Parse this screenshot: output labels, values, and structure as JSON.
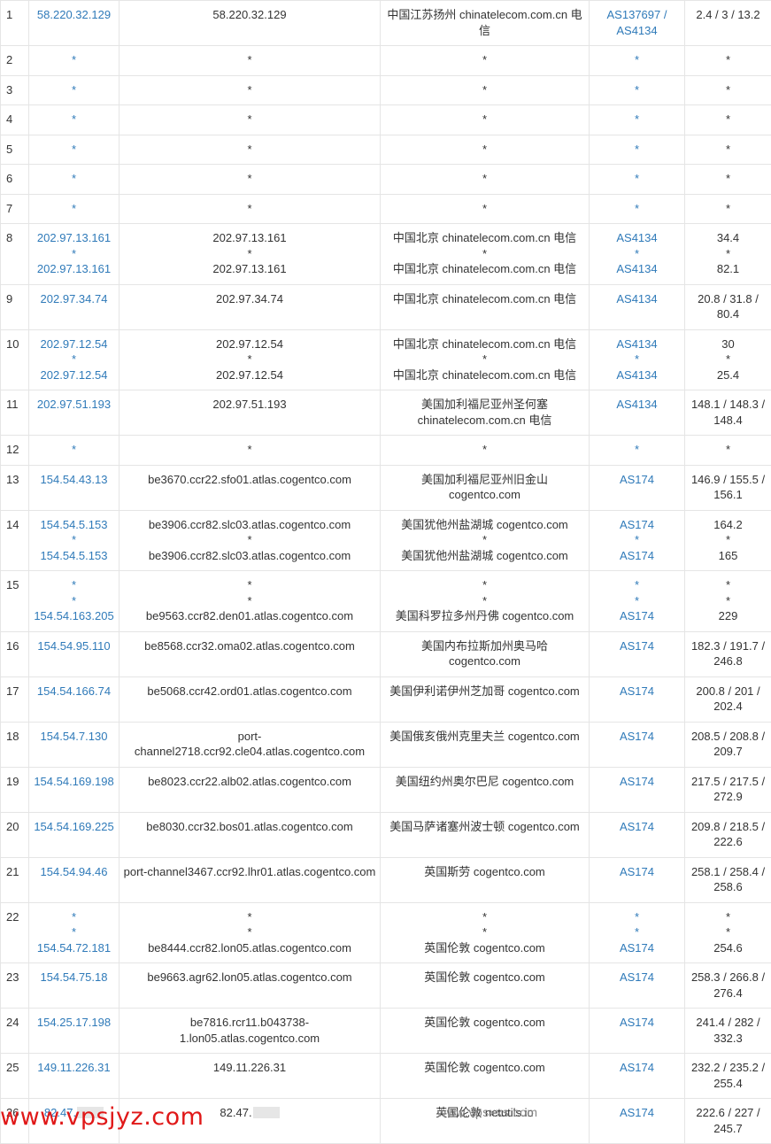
{
  "rows": [
    {
      "hop": "1",
      "ips": [
        "58.220.32.129"
      ],
      "hosts": [
        "58.220.32.129"
      ],
      "locs": [
        "中国江苏扬州 chinatelecom.com.cn 电信"
      ],
      "asns": [
        "AS137697 / AS4134"
      ],
      "times": [
        "2.4 / 3 / 13.2"
      ]
    },
    {
      "hop": "2",
      "ips": [
        "*"
      ],
      "hosts": [
        "*"
      ],
      "locs": [
        "*"
      ],
      "asns": [
        "*"
      ],
      "times": [
        "*"
      ]
    },
    {
      "hop": "3",
      "ips": [
        "*"
      ],
      "hosts": [
        "*"
      ],
      "locs": [
        "*"
      ],
      "asns": [
        "*"
      ],
      "times": [
        "*"
      ]
    },
    {
      "hop": "4",
      "ips": [
        "*"
      ],
      "hosts": [
        "*"
      ],
      "locs": [
        "*"
      ],
      "asns": [
        "*"
      ],
      "times": [
        "*"
      ]
    },
    {
      "hop": "5",
      "ips": [
        "*"
      ],
      "hosts": [
        "*"
      ],
      "locs": [
        "*"
      ],
      "asns": [
        "*"
      ],
      "times": [
        "*"
      ]
    },
    {
      "hop": "6",
      "ips": [
        "*"
      ],
      "hosts": [
        "*"
      ],
      "locs": [
        "*"
      ],
      "asns": [
        "*"
      ],
      "times": [
        "*"
      ]
    },
    {
      "hop": "7",
      "ips": [
        "*"
      ],
      "hosts": [
        "*"
      ],
      "locs": [
        "*"
      ],
      "asns": [
        "*"
      ],
      "times": [
        "*"
      ]
    },
    {
      "hop": "8",
      "ips": [
        "202.97.13.161",
        "*",
        "202.97.13.161"
      ],
      "hosts": [
        "202.97.13.161",
        "*",
        "202.97.13.161"
      ],
      "locs": [
        "中国北京 chinatelecom.com.cn 电信",
        "*",
        "中国北京 chinatelecom.com.cn 电信"
      ],
      "asns": [
        "AS4134",
        "*",
        "AS4134"
      ],
      "times": [
        "34.4",
        "*",
        "82.1"
      ]
    },
    {
      "hop": "9",
      "ips": [
        "202.97.34.74"
      ],
      "hosts": [
        "202.97.34.74"
      ],
      "locs": [
        "中国北京 chinatelecom.com.cn 电信"
      ],
      "asns": [
        "AS4134"
      ],
      "times": [
        "20.8 / 31.8 / 80.4"
      ]
    },
    {
      "hop": "10",
      "ips": [
        "202.97.12.54",
        "*",
        "202.97.12.54"
      ],
      "hosts": [
        "202.97.12.54",
        "*",
        "202.97.12.54"
      ],
      "locs": [
        "中国北京 chinatelecom.com.cn 电信",
        "*",
        "中国北京 chinatelecom.com.cn 电信"
      ],
      "asns": [
        "AS4134",
        "*",
        "AS4134"
      ],
      "times": [
        "30",
        "*",
        "25.4"
      ]
    },
    {
      "hop": "11",
      "ips": [
        "202.97.51.193"
      ],
      "hosts": [
        "202.97.51.193"
      ],
      "locs": [
        "美国加利福尼亚州圣何塞 chinatelecom.com.cn 电信"
      ],
      "asns": [
        "AS4134"
      ],
      "times": [
        "148.1 / 148.3 / 148.4"
      ]
    },
    {
      "hop": "12",
      "ips": [
        "*"
      ],
      "hosts": [
        "*"
      ],
      "locs": [
        "*"
      ],
      "asns": [
        "*"
      ],
      "times": [
        "*"
      ]
    },
    {
      "hop": "13",
      "ips": [
        "154.54.43.13"
      ],
      "hosts": [
        "be3670.ccr22.sfo01.atlas.cogentco.com"
      ],
      "locs": [
        "美国加利福尼亚州旧金山 cogentco.com"
      ],
      "asns": [
        "AS174"
      ],
      "times": [
        "146.9 / 155.5 / 156.1"
      ]
    },
    {
      "hop": "14",
      "ips": [
        "154.54.5.153",
        "*",
        "154.54.5.153"
      ],
      "hosts": [
        "be3906.ccr82.slc03.atlas.cogentco.com",
        "*",
        "be3906.ccr82.slc03.atlas.cogentco.com"
      ],
      "locs": [
        "美国犹他州盐湖城 cogentco.com",
        "*",
        "美国犹他州盐湖城 cogentco.com"
      ],
      "asns": [
        "AS174",
        "*",
        "AS174"
      ],
      "times": [
        "164.2",
        "*",
        "165"
      ]
    },
    {
      "hop": "15",
      "ips": [
        "*",
        "*",
        "154.54.163.205"
      ],
      "hosts": [
        "*",
        "*",
        "be9563.ccr82.den01.atlas.cogentco.com"
      ],
      "locs": [
        "*",
        "*",
        "美国科罗拉多州丹佛 cogentco.com"
      ],
      "asns": [
        "*",
        "*",
        "AS174"
      ],
      "times": [
        "*",
        "*",
        "229"
      ]
    },
    {
      "hop": "16",
      "ips": [
        "154.54.95.110"
      ],
      "hosts": [
        "be8568.ccr32.oma02.atlas.cogentco.com"
      ],
      "locs": [
        "美国内布拉斯加州奥马哈 cogentco.com"
      ],
      "asns": [
        "AS174"
      ],
      "times": [
        "182.3 / 191.7 / 246.8"
      ]
    },
    {
      "hop": "17",
      "ips": [
        "154.54.166.74"
      ],
      "hosts": [
        "be5068.ccr42.ord01.atlas.cogentco.com"
      ],
      "locs": [
        "美国伊利诺伊州芝加哥 cogentco.com"
      ],
      "asns": [
        "AS174"
      ],
      "times": [
        "200.8 / 201 / 202.4"
      ]
    },
    {
      "hop": "18",
      "ips": [
        "154.54.7.130"
      ],
      "hosts": [
        "port-channel2718.ccr92.cle04.atlas.cogentco.com"
      ],
      "locs": [
        "美国俄亥俄州克里夫兰 cogentco.com"
      ],
      "asns": [
        "AS174"
      ],
      "times": [
        "208.5 / 208.8 / 209.7"
      ]
    },
    {
      "hop": "19",
      "ips": [
        "154.54.169.198"
      ],
      "hosts": [
        "be8023.ccr22.alb02.atlas.cogentco.com"
      ],
      "locs": [
        "美国纽约州奥尔巴尼 cogentco.com"
      ],
      "asns": [
        "AS174"
      ],
      "times": [
        "217.5 / 217.5 / 272.9"
      ]
    },
    {
      "hop": "20",
      "ips": [
        "154.54.169.225"
      ],
      "hosts": [
        "be8030.ccr32.bos01.atlas.cogentco.com"
      ],
      "locs": [
        "美国马萨诸塞州波士顿 cogentco.com"
      ],
      "asns": [
        "AS174"
      ],
      "times": [
        "209.8 / 218.5 / 222.6"
      ]
    },
    {
      "hop": "21",
      "ips": [
        "154.54.94.46"
      ],
      "hosts": [
        "port-channel3467.ccr92.lhr01.atlas.cogentco.com"
      ],
      "locs": [
        "英国斯劳 cogentco.com"
      ],
      "asns": [
        "AS174"
      ],
      "times": [
        "258.1 / 258.4 / 258.6"
      ]
    },
    {
      "hop": "22",
      "ips": [
        "*",
        "*",
        "154.54.72.181"
      ],
      "hosts": [
        "*",
        "*",
        "be8444.ccr82.lon05.atlas.cogentco.com"
      ],
      "locs": [
        "*",
        "*",
        "英国伦敦 cogentco.com"
      ],
      "asns": [
        "*",
        "*",
        "AS174"
      ],
      "times": [
        "*",
        "*",
        "254.6"
      ]
    },
    {
      "hop": "23",
      "ips": [
        "154.54.75.18"
      ],
      "hosts": [
        "be9663.agr62.lon05.atlas.cogentco.com"
      ],
      "locs": [
        "英国伦敦 cogentco.com"
      ],
      "asns": [
        "AS174"
      ],
      "times": [
        "258.3 / 266.8 / 276.4"
      ]
    },
    {
      "hop": "24",
      "ips": [
        "154.25.17.198"
      ],
      "hosts": [
        "be7816.rcr11.b043738-1.lon05.atlas.cogentco.com"
      ],
      "locs": [
        "英国伦敦 cogentco.com"
      ],
      "asns": [
        "AS174"
      ],
      "times": [
        "241.4 / 282 / 332.3"
      ]
    },
    {
      "hop": "25",
      "ips": [
        "149.11.226.31"
      ],
      "hosts": [
        "149.11.226.31"
      ],
      "locs": [
        "英国伦敦 cogentco.com"
      ],
      "asns": [
        "AS174"
      ],
      "times": [
        "232.2 / 235.2 / 255.4"
      ]
    },
    {
      "hop": "26",
      "ips": [
        "82.47."
      ],
      "hosts": [
        "82.47."
      ],
      "locs": [
        "英国伦敦 netutils.io"
      ],
      "asns": [
        "AS174"
      ],
      "times": [
        "222.6 / 227 / 245.7"
      ]
    }
  ],
  "watermarks": {
    "red": "www.vpsjyz.com",
    "gray": "www.vpsxxs.com"
  }
}
